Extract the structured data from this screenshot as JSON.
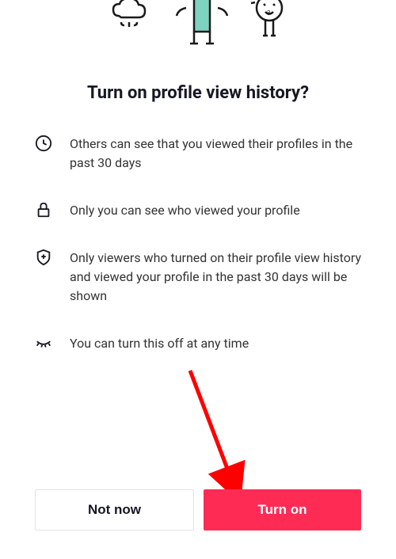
{
  "title": "Turn on profile view history?",
  "features": {
    "f1": "Others can see that you viewed their profiles in the past 30 days",
    "f2": "Only you can see who viewed your profile",
    "f3": "Only viewers who turned on their profile view history and viewed your profile in the past 30 days will be shown",
    "f4": "You can turn this off at any time"
  },
  "buttons": {
    "secondary": "Not now",
    "primary": "Turn on"
  },
  "colors": {
    "primary": "#fe2c55"
  }
}
